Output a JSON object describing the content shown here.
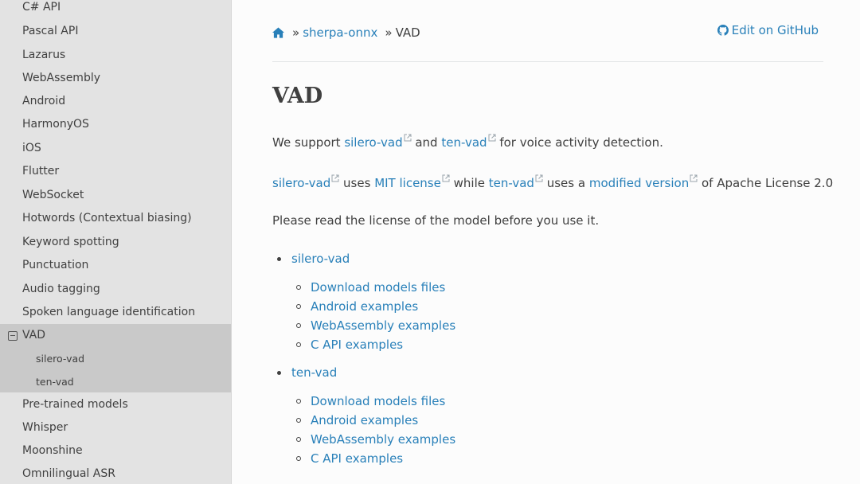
{
  "sidebar": {
    "items_top": [
      {
        "label": "C# API"
      },
      {
        "label": "Pascal API"
      },
      {
        "label": "Lazarus"
      },
      {
        "label": "WebAssembly"
      },
      {
        "label": "Android"
      },
      {
        "label": "HarmonyOS"
      },
      {
        "label": "iOS"
      },
      {
        "label": "Flutter"
      },
      {
        "label": "WebSocket"
      },
      {
        "label": "Hotwords (Contextual biasing)"
      },
      {
        "label": "Keyword spotting"
      },
      {
        "label": "Punctuation"
      },
      {
        "label": "Audio tagging"
      },
      {
        "label": "Spoken language identification"
      }
    ],
    "current": {
      "label": "VAD",
      "children": [
        {
          "label": "silero-vad"
        },
        {
          "label": "ten-vad"
        }
      ]
    },
    "items_bottom": [
      {
        "label": "Pre-trained models"
      },
      {
        "label": "Whisper"
      },
      {
        "label": "Moonshine"
      },
      {
        "label": "Omnilingual ASR"
      }
    ]
  },
  "breadcrumb": {
    "sep1": "»",
    "link": "sherpa-onnx",
    "sep2": "»",
    "current": "VAD",
    "home_icon": "home-icon"
  },
  "edit_on_github": {
    "label": "Edit on GitHub",
    "icon": "github-icon"
  },
  "page_title": "VAD",
  "para1": {
    "t1": "We support ",
    "link1": "silero-vad",
    "t2": " and ",
    "link2": "ten-vad",
    "t3": " for voice activity detection."
  },
  "para2": {
    "link1": "silero-vad",
    "t1": " uses ",
    "link2": "MIT license",
    "t2": " while ",
    "link3": "ten-vad",
    "t3": " uses a ",
    "link4": "modified version",
    "t4": " of Apache License 2.0"
  },
  "para3": "Please read the license of the model before you use it.",
  "toc": [
    {
      "label": "silero-vad",
      "children": [
        {
          "label": "Download models files"
        },
        {
          "label": "Android examples"
        },
        {
          "label": "WebAssembly examples"
        },
        {
          "label": "C API examples"
        }
      ]
    },
    {
      "label": "ten-vad",
      "children": [
        {
          "label": "Download models files"
        },
        {
          "label": "Android examples"
        },
        {
          "label": "WebAssembly examples"
        },
        {
          "label": "C API examples"
        }
      ]
    }
  ],
  "colors": {
    "link": "#2980b9",
    "text": "#404040",
    "sidebar_bg": "#e3e3e3",
    "sidebar_current": "#c9c9c9"
  }
}
